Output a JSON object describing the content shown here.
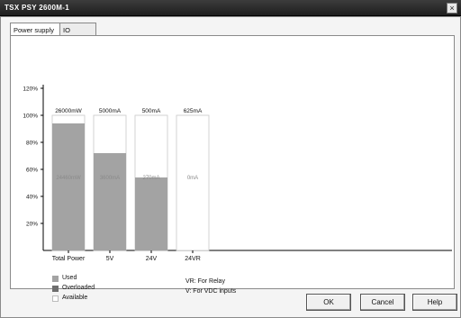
{
  "window": {
    "title": "TSX PSY 2600M-1",
    "close_label": "×"
  },
  "tabs": [
    {
      "label": "Power supply"
    },
    {
      "label": "IO"
    }
  ],
  "chart_data": {
    "type": "bar",
    "ylim": [
      0,
      120
    ],
    "yticks": [
      20,
      40,
      60,
      80,
      100,
      120
    ],
    "ytick_labels": [
      "20%",
      "40%",
      "60%",
      "80%",
      "100%",
      "120%"
    ],
    "categories": [
      "Total Power",
      "5V",
      "24V",
      "24VR"
    ],
    "capacity_labels": [
      "26000mW",
      "5000mA",
      "500mA",
      "625mA"
    ],
    "used_labels": [
      "24460mW",
      "3600mA",
      "270mA",
      "0mA"
    ],
    "used_percent": [
      94,
      72,
      54,
      0
    ],
    "available_percent": [
      100,
      100,
      100,
      100
    ],
    "colors": {
      "used": "#a3a3a3",
      "available": "#ffffff",
      "overloaded": "#6e6e6e"
    }
  },
  "legend": [
    {
      "label": "Used",
      "color": "#a3a3a3"
    },
    {
      "label": "Overloaded",
      "color": "#6e6e6e"
    },
    {
      "label": "Available",
      "color": "#ffffff"
    }
  ],
  "notes": [
    {
      "text": "VR: For Relay"
    },
    {
      "text": "V: For VDC inputs"
    }
  ],
  "buttons": {
    "ok": "OK",
    "cancel": "Cancel",
    "help": "Help"
  }
}
